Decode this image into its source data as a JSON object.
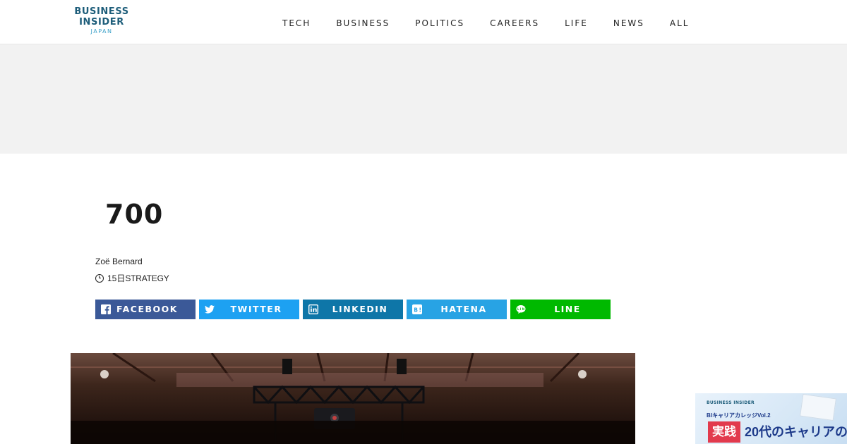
{
  "header": {
    "logo": {
      "line1": "BUSINESS",
      "line2": "INSIDER",
      "line3": "JAPAN"
    },
    "nav": [
      "TECH",
      "BUSINESS",
      "POLITICS",
      "CAREERS",
      "LIFE",
      "NEWS",
      "ALL"
    ]
  },
  "article": {
    "title": "700",
    "author": "Zoë Bernard",
    "time": "15日",
    "category": "STRATEGY"
  },
  "share": {
    "facebook": "FACEBOOK",
    "twitter": "TWITTER",
    "linkedin": "LINKEDIN",
    "hatena": "HATENA",
    "line": "LINE"
  },
  "colors": {
    "brand": "#1d5d7a",
    "facebook": "#3b5998",
    "twitter": "#1da1f2",
    "linkedin": "#0e76a8",
    "hatena": "#28a3e4",
    "line": "#00b900"
  },
  "corner_ad": {
    "brand": "BUSINESS INSIDER",
    "subtitle": "BIキャリアカレッジVol.2",
    "tag": "実践",
    "headline": "20代のキャリアの"
  }
}
